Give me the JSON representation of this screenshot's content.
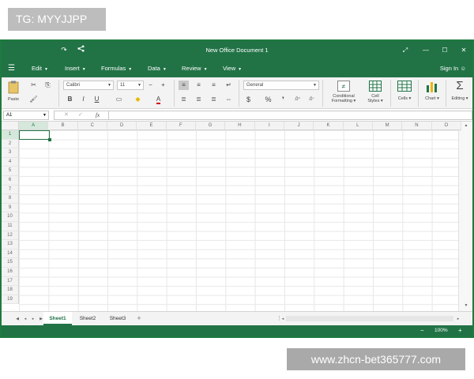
{
  "watermarks": {
    "top": "TG: MYYJJPP",
    "bottom": "www.zhcn-bet365777.com"
  },
  "window": {
    "title": "New Office Document 1"
  },
  "menu": {
    "items": [
      {
        "label": "Edit"
      },
      {
        "label": "Insert"
      },
      {
        "label": "Formulas"
      },
      {
        "label": "Data"
      },
      {
        "label": "Review"
      },
      {
        "label": "View"
      }
    ],
    "sign_in": "Sign In"
  },
  "ribbon": {
    "paste_label": "Paste",
    "font_name": "Calibri",
    "font_size": "11",
    "bold": "B",
    "italic": "I",
    "underline": "U",
    "number_format": "General",
    "currency_symbol": "$",
    "percent_symbol": "%",
    "comma_symbol": "❜",
    "conditional_formatting": [
      "Conditional",
      "Formatting ▾"
    ],
    "cell_styles": [
      "Cell",
      "Styles ▾"
    ],
    "cells": "Cells",
    "chart": "Chart",
    "editing": "Editing"
  },
  "formula_bar": {
    "name_box": "A1",
    "fx": "fx"
  },
  "grid": {
    "columns": [
      "A",
      "B",
      "C",
      "D",
      "E",
      "F",
      "G",
      "H",
      "I",
      "J",
      "K",
      "L",
      "M",
      "N",
      "O"
    ],
    "rows": [
      "1",
      "2",
      "3",
      "4",
      "5",
      "6",
      "7",
      "8",
      "9",
      "10",
      "11",
      "12",
      "13",
      "14",
      "15",
      "16",
      "17",
      "18",
      "19"
    ],
    "active_cell": "A1"
  },
  "sheets": [
    {
      "label": "Sheet1",
      "active": true
    },
    {
      "label": "Sheet2",
      "active": false
    },
    {
      "label": "Sheet3",
      "active": false
    }
  ],
  "status": {
    "zoom": "100%"
  },
  "colors": {
    "brand": "#217346",
    "ribbon_bg": "#f3f3f3"
  }
}
